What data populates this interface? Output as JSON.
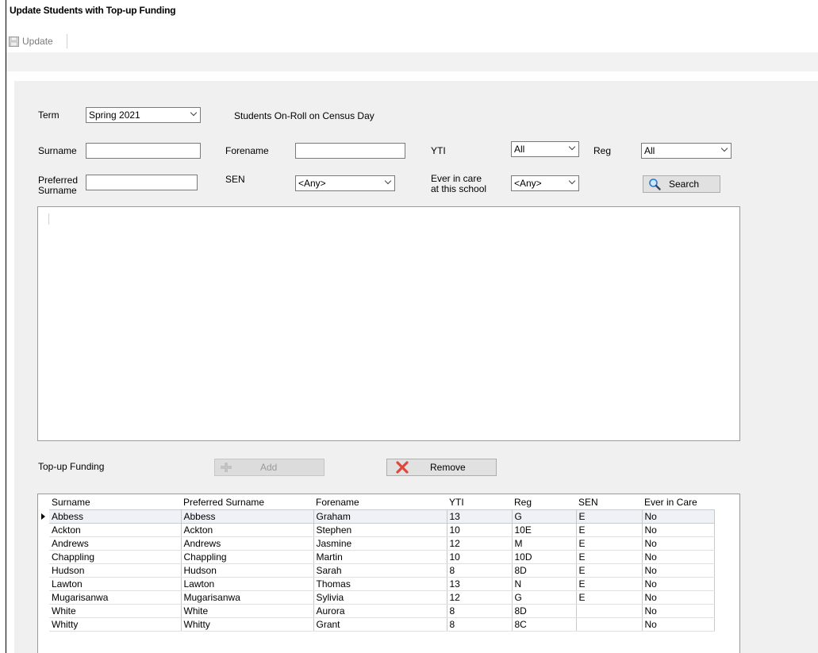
{
  "window": {
    "title": "Update Students with Top-up Funding"
  },
  "toolbar": {
    "update_label": "Update"
  },
  "search": {
    "term_label": "Term",
    "term_value": "Spring 2021",
    "census_label": "Students On-Roll on Census Day",
    "surname_label": "Surname",
    "surname_value": "",
    "forename_label": "Forename",
    "forename_value": "",
    "yti_label": "YTI",
    "yti_value": "All",
    "reg_label": "Reg",
    "reg_value": "All",
    "preferred_surname_label_1": "Preferred",
    "preferred_surname_label_2": "Surname",
    "preferred_surname_value": "",
    "sen_label": "SEN",
    "sen_value": "<Any>",
    "ever_in_care_label_1": "Ever in care",
    "ever_in_care_label_2": "at this school",
    "ever_in_care_value": "<Any>",
    "search_button": "Search"
  },
  "funding": {
    "label": "Top-up Funding",
    "add_button": "Add",
    "remove_button": "Remove"
  },
  "grid": {
    "columns": [
      "Surname",
      "Preferred Surname",
      "Forename",
      "YTI",
      "Reg",
      "SEN",
      "Ever in Care"
    ],
    "rows": [
      [
        "Abbess",
        "Abbess",
        "Graham",
        "13",
        "G",
        "E",
        "No"
      ],
      [
        "Ackton",
        "Ackton",
        "Stephen",
        "10",
        "10E",
        "E",
        "No"
      ],
      [
        "Andrews",
        "Andrews",
        "Jasmine",
        "12",
        "M",
        "E",
        "No"
      ],
      [
        "Chappling",
        "Chappling",
        "Martin",
        "10",
        "10D",
        "E",
        "No"
      ],
      [
        "Hudson",
        "Hudson",
        "Sarah",
        "8",
        "8D",
        "E",
        "No"
      ],
      [
        "Lawton",
        "Lawton",
        "Thomas",
        "13",
        "N",
        "E",
        "No"
      ],
      [
        "Mugarisanwa",
        "Mugarisanwa",
        "Sylivia",
        "12",
        "G",
        "E",
        "No"
      ],
      [
        "White",
        "White",
        "Aurora",
        "8",
        "8D",
        "",
        "No"
      ],
      [
        "Whitty",
        "Whitty",
        "Grant",
        "8",
        "8C",
        "",
        "No"
      ]
    ]
  },
  "colors": {
    "remove_icon": "#e0463a",
    "search_icon": "#2a79c8",
    "selected_row": "#eef1f6"
  }
}
